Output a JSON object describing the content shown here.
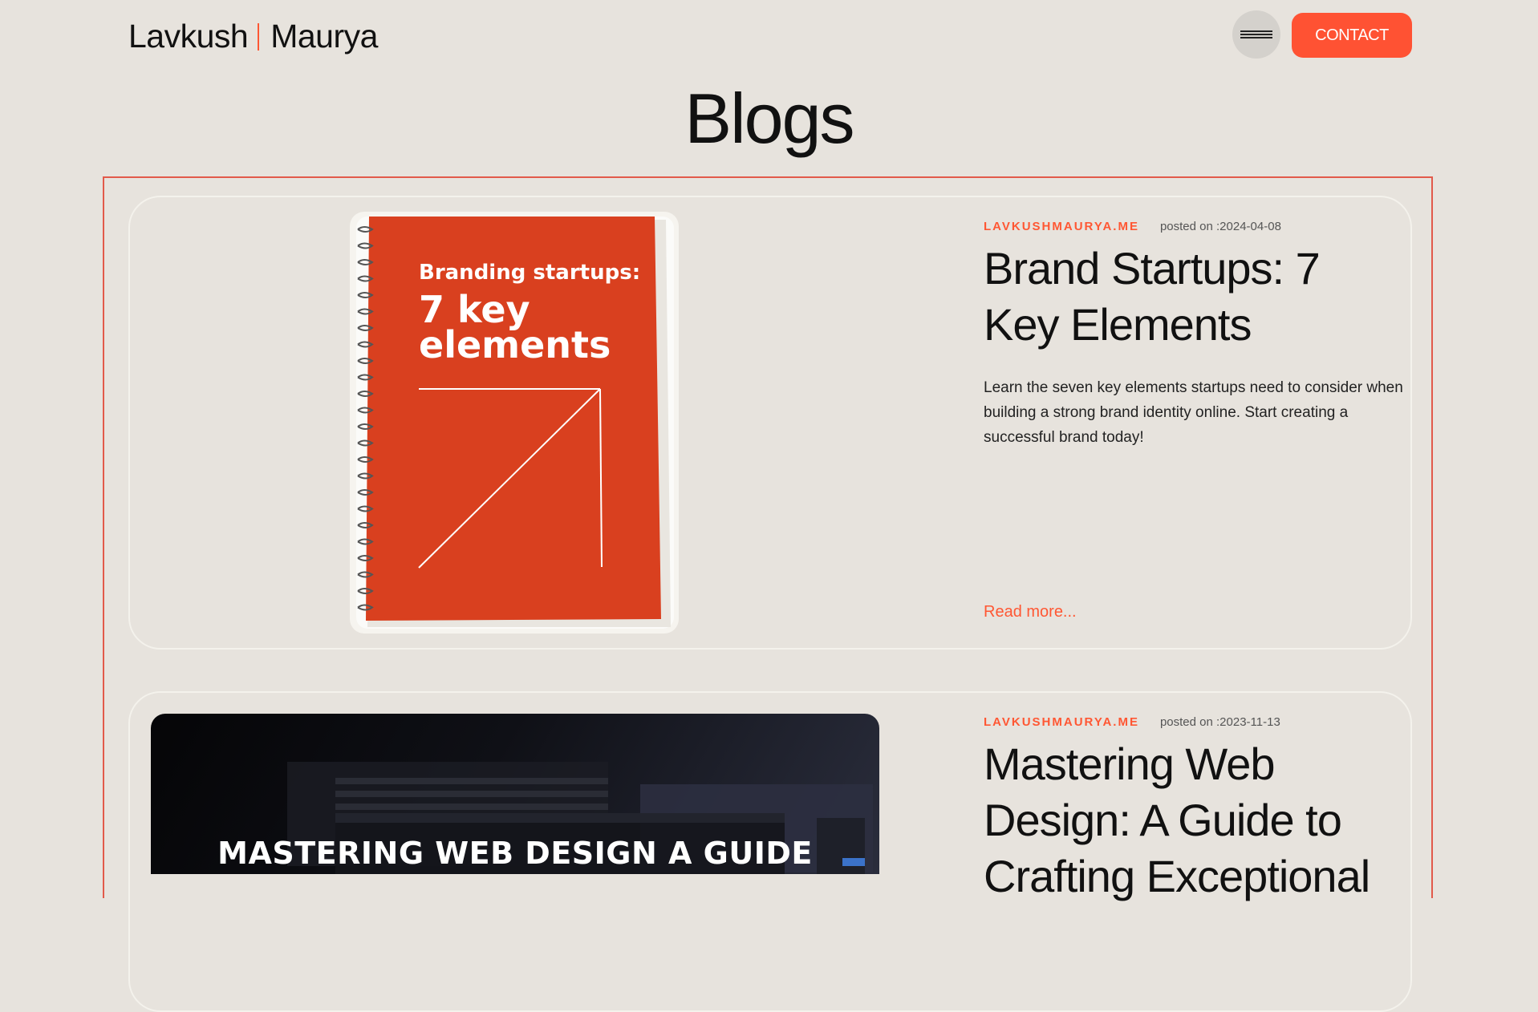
{
  "header": {
    "logo_first": "Lavkush",
    "logo_last": "Maurya",
    "menu_icon": "hamburger-icon",
    "contact_label": "CONTACT"
  },
  "page": {
    "title": "Blogs"
  },
  "posts": [
    {
      "site": "LAVKUSHMAURYA.ME",
      "posted": "posted on :2024-04-08",
      "title": "Brand Startups: 7 Key Elements",
      "excerpt": "Learn the seven key elements startups need to consider when building a strong brand identity online. Start creating a successful brand today!",
      "read_more": "Read more...",
      "image": {
        "heading": "Branding startups:",
        "line1": "7 key",
        "line2": "elements"
      }
    },
    {
      "site": "LAVKUSHMAURYA.ME",
      "posted": "posted on :2023-11-13",
      "title": "Mastering Web Design: A Guide to Crafting Exceptional",
      "image": {
        "caption": "MASTERING WEB DESIGN A GUIDE"
      }
    }
  ],
  "colors": {
    "accent": "#ff5733",
    "background": "#e7e3dd",
    "notebook": "#d9401f"
  }
}
